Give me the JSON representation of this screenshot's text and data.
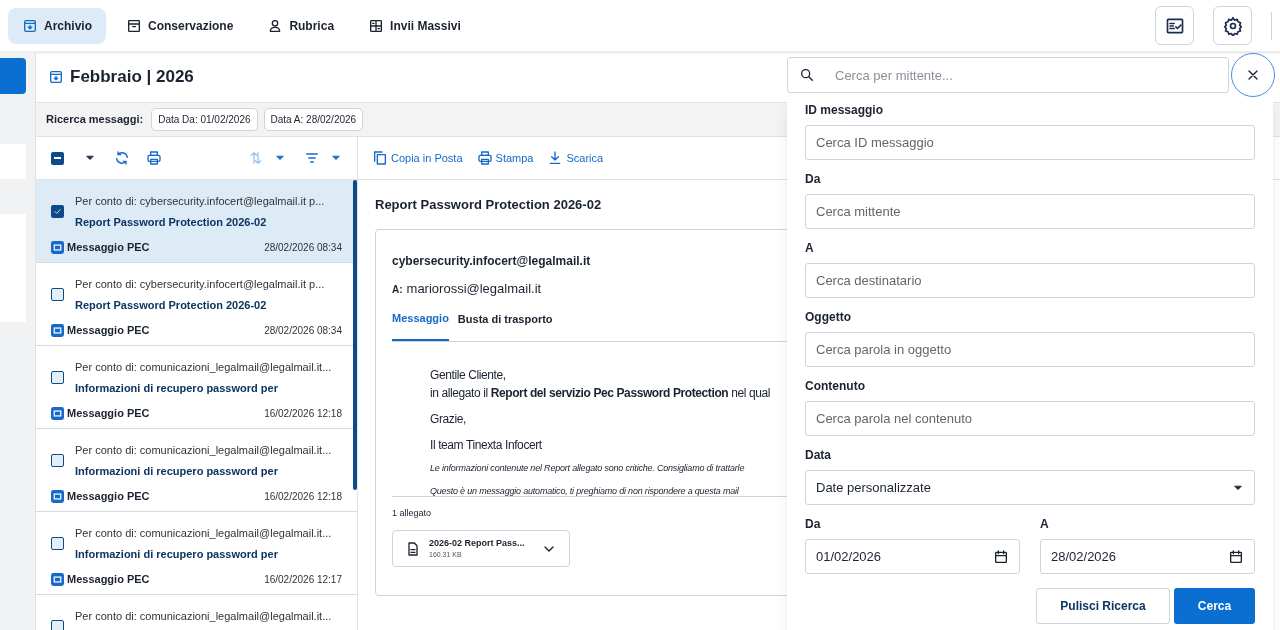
{
  "nav": {
    "tabs": [
      {
        "label": "Archivio",
        "selected": true
      },
      {
        "label": "Conservazione",
        "selected": false
      },
      {
        "label": "Rubrica",
        "selected": false
      },
      {
        "label": "Invii Massivi",
        "selected": false
      }
    ]
  },
  "header": {
    "title": "Febbraio | 2026"
  },
  "filters": {
    "label": "Ricerca messaggi:",
    "chips": [
      "Data Da: 01/02/2026",
      "Data A: 28/02/2026"
    ]
  },
  "list": {
    "select_all_indeterminate": true,
    "messages": [
      {
        "from": "Per conto di: cybersecurity.infocert@legalmail.it p...",
        "subject": "Report Password Protection 2026-02",
        "type": "Messaggio PEC",
        "date": "28/02/2026 08:34",
        "selected": true,
        "checked": true
      },
      {
        "from": "Per conto di: cybersecurity.infocert@legalmail.it p...",
        "subject": "Report Password Protection 2026-02",
        "type": "Messaggio PEC",
        "date": "28/02/2026 08:34",
        "selected": false,
        "checked": false
      },
      {
        "from": "Per conto di: comunicazioni_legalmail@legalmail.it...",
        "subject": "Informazioni di recupero password per",
        "type": "Messaggio PEC",
        "date": "16/02/2026 12:18",
        "selected": false,
        "checked": false
      },
      {
        "from": "Per conto di: comunicazioni_legalmail@legalmail.it...",
        "subject": "Informazioni di recupero password per",
        "type": "Messaggio PEC",
        "date": "16/02/2026 12:18",
        "selected": false,
        "checked": false
      },
      {
        "from": "Per conto di: comunicazioni_legalmail@legalmail.it...",
        "subject": "Informazioni di recupero password per",
        "type": "Messaggio PEC",
        "date": "16/02/2026 12:17",
        "selected": false,
        "checked": false
      },
      {
        "from": "Per conto di: comunicazioni_legalmail@legalmail.it...",
        "selected": false,
        "checked": false
      }
    ]
  },
  "reader": {
    "actions": [
      {
        "label": "Copia in Posta"
      },
      {
        "label": "Stampa"
      },
      {
        "label": "Scarica"
      }
    ],
    "subject": "Report Password Protection 2026-02",
    "sender": "cybersecurity.infocert@legalmail.it",
    "to_label": "A:",
    "to": "mariorossi@legalmail.it",
    "tabs": [
      {
        "label": "Messaggio",
        "selected": true
      },
      {
        "label": "Busta di trasporto",
        "selected": false
      }
    ],
    "body": [
      {
        "kind": "plain",
        "text": "Gentile Cliente,"
      },
      {
        "kind": "plain",
        "text": "in allegato il **Report del servizio Pec Password Protection** nel qual"
      },
      {
        "kind": "plain",
        "text": "Grazie,"
      },
      {
        "kind": "plain",
        "text": "Il team Tinexta Infocert"
      },
      {
        "kind": "note",
        "text": "Le informazioni contenute nel Report allegato sono critiche. Consigliamo di trattarle"
      },
      {
        "kind": "note",
        "text": "Questo è un messaggio automatico, ti preghiamo di non rispondere a questa mail"
      }
    ],
    "attachments_label": "1 allegato",
    "attachment": {
      "name": "2026-02 Report Pass...",
      "size": "160.31 KB"
    }
  },
  "search": {
    "placeholder": "Cerca per mittente...",
    "fields": [
      {
        "label": "ID messaggio",
        "placeholder": "Cerca ID messaggio"
      },
      {
        "label": "Da",
        "placeholder": "Cerca mittente"
      },
      {
        "label": "A",
        "placeholder": "Cerca destinatario"
      },
      {
        "label": "Oggetto",
        "placeholder": "Cerca parola in oggetto"
      },
      {
        "label": "Contenuto",
        "placeholder": "Cerca parola nel contenuto"
      }
    ],
    "date": {
      "label": "Data",
      "value": "Date personalizzate"
    },
    "range": [
      {
        "label": "Da",
        "value": "01/02/2026"
      },
      {
        "label": "A",
        "value": "28/02/2026"
      }
    ],
    "buttons": [
      {
        "label": "Pulisci Ricerca",
        "kind": "secondary"
      },
      {
        "label": "Cerca",
        "kind": "primary"
      }
    ]
  }
}
